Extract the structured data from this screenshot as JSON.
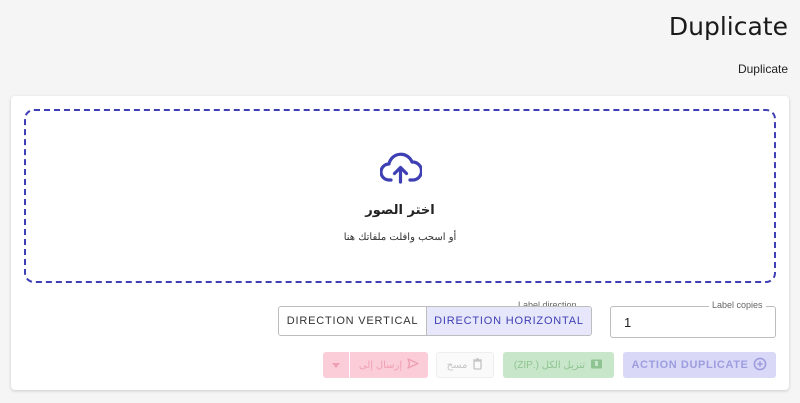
{
  "header": {
    "title": "Duplicate",
    "breadcrumb": "Duplicate"
  },
  "dropzone": {
    "title": "اختر الصور",
    "hint": "أو اسحب وافلت ملفاتك هنا",
    "icon": "cloud-upload-icon",
    "border_color": "#3f3fb5"
  },
  "direction": {
    "label": "Label direction",
    "options": [
      "DIRECTION VERTICAL",
      "DIRECTION HORIZONTAL"
    ],
    "selected": "DIRECTION HORIZONTAL"
  },
  "copies": {
    "label": "Label copies",
    "value": "1"
  },
  "actions": {
    "duplicate_label": "ACTION DUPLICATE",
    "zip_label": "تنزيل الكل (.ZIP)",
    "delete_label": "مسح",
    "send_label": "إرسال إلى"
  },
  "colors": {
    "accent": "#3f3fb5",
    "selected_bg": "#e6e7fa",
    "zip_bg": "#c8e6c9",
    "send_bg": "#fbcdd8",
    "duplicate_bg": "#d9d9f7"
  }
}
